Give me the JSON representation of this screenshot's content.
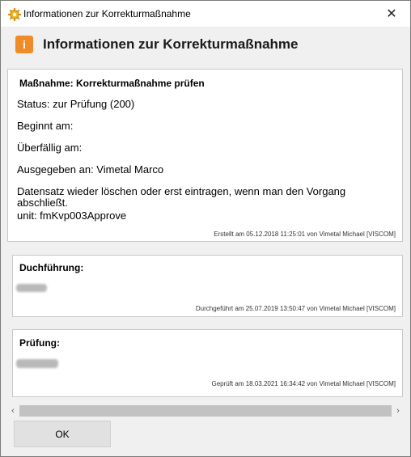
{
  "window": {
    "title": "Informationen zur Korrekturmaßnahme",
    "close_glyph": "✕"
  },
  "header": {
    "icon_glyph": "i",
    "heading": "Informationen zur Korrekturmaßnahme"
  },
  "panels": {
    "measure": {
      "title": "Maßnahme: Korrekturmaßnahme prüfen",
      "status": "Status: zur Prüfung (200)",
      "begins": "Beginnt am:",
      "overdue": "Überfällig am:",
      "issued_to": "Ausgegeben an: Vimetal Marco",
      "description_line1": "Datensatz wieder löschen oder erst eintragen, wenn man den Vorgang",
      "description_line2": "abschließt.",
      "unit": "unit: fmKvp003Approve",
      "footer": "Erstellt am 05.12.2018 11:25:01 von Vimetal Michael [VISCOM]"
    },
    "execution": {
      "title": "Duchführung:",
      "footer": "Durchgeführt am 25.07.2019 13:50:47 von Vimetal Michael [VISCOM]"
    },
    "review": {
      "title": "Prüfung:",
      "footer": "Geprüft am 18.03.2021 16:34:42 von Vimetal Michael [VISCOM]"
    }
  },
  "scrollbar": {
    "left_glyph": "‹",
    "right_glyph": "›"
  },
  "buttons": {
    "ok_label": "OK"
  },
  "colors": {
    "accent_icon": "#f08c28",
    "app_icon": "#f2b72c"
  },
  "icons": {
    "app": "gear-icon",
    "header": "info-icon",
    "close": "close-icon"
  }
}
